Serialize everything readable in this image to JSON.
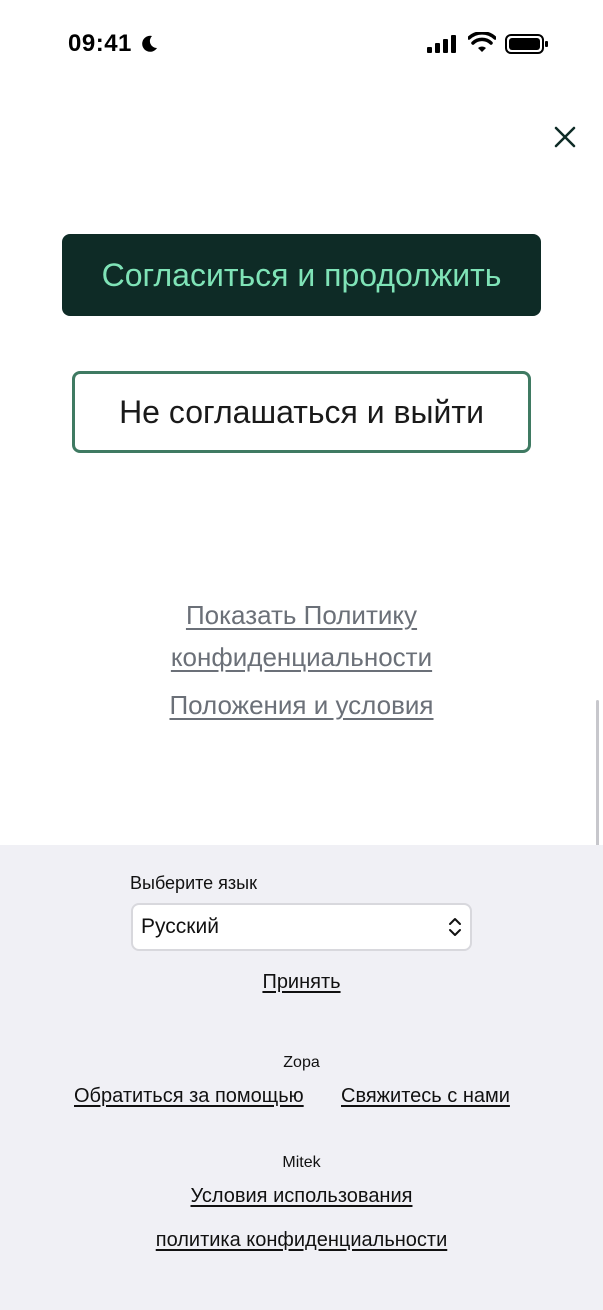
{
  "status_bar": {
    "time": "09:41"
  },
  "modal": {
    "agree_button": "Согласиться и продолжить",
    "decline_button": "Не соглашаться и выйти",
    "privacy_link": "Показать Политику конфиденциальности",
    "terms_link": "Положения и условия"
  },
  "footer": {
    "language_label": "Выберите язык",
    "language_selected": "Русский",
    "accept_link": "Принять",
    "zopa_label": "Zopa",
    "help_link": "Обратиться за помощью",
    "contact_link": "Свяжитесь с нами",
    "mitek_label": "Mitek",
    "terms_of_use_link": "Условия использования",
    "privacy_policy_link": "политика конфиденциальности"
  },
  "colors": {
    "primary_button_bg": "#0e2b26",
    "primary_button_text": "#7fe3b7",
    "secondary_button_border": "#3f7a62",
    "footer_bg": "#f0f0f5"
  },
  "icons": [
    "moon-icon",
    "cellular-signal-icon",
    "wifi-icon",
    "battery-icon",
    "close-icon",
    "chevron-up-down-icon"
  ]
}
